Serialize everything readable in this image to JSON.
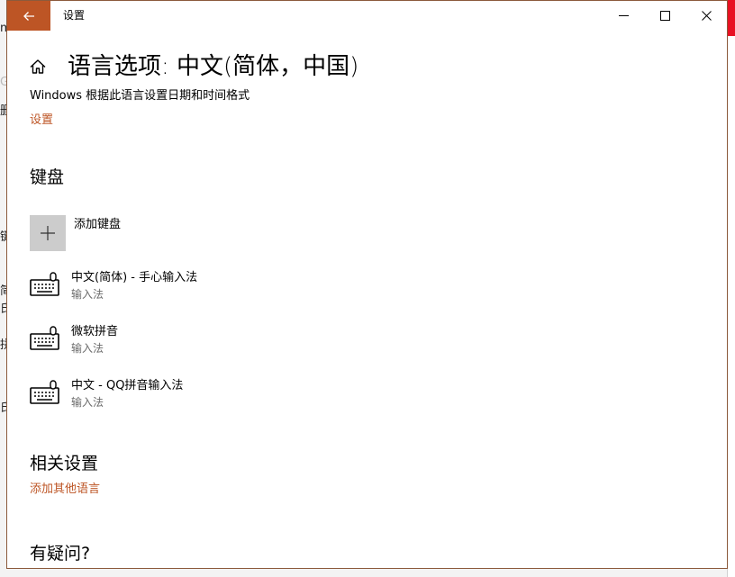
{
  "window": {
    "title": "设置",
    "controls": {
      "minimize_icon": "minimize-icon",
      "maximize_icon": "maximize-icon",
      "close_icon": "close-icon"
    },
    "accent_color": "#bd5525"
  },
  "header": {
    "title": "语言选项: 中文(简体，中国)",
    "description": "Windows 根据此语言设置日期和时间格式",
    "settings_link": "设置"
  },
  "keyboard": {
    "title": "键盘",
    "add_label": "添加键盘",
    "items": [
      {
        "name": "中文(简体) - 手心输入法",
        "type": "输入法"
      },
      {
        "name": "微软拼音",
        "type": "输入法"
      },
      {
        "name": "中文 - QQ拼音输入法",
        "type": "输入法"
      }
    ]
  },
  "related": {
    "title": "相关设置",
    "add_language_link": "添加其他语言"
  },
  "questions": {
    "title": "有疑问?"
  },
  "background_window": {
    "fragments": [
      "m",
      "G",
      "删",
      "键",
      "简",
      "氏",
      "拼",
      "氏"
    ]
  }
}
